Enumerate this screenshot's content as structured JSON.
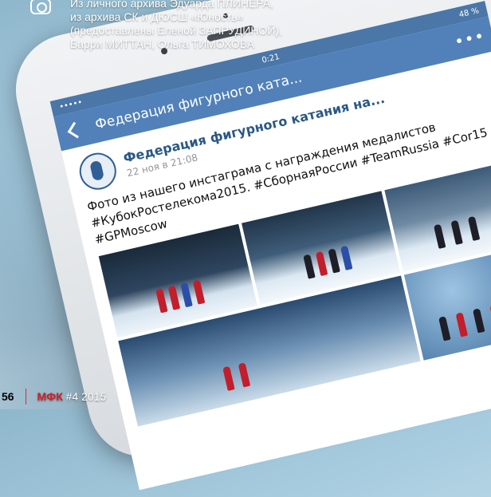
{
  "credits": {
    "lines": [
      "Из личного архива Эдуарда ПЛИНЕРА,",
      "из архива СК и ДЮСШ «Юность»",
      "(предоставлены Еленой ЗАПРУДИНОЙ),",
      "Барри МИТТАН, Ольга ТИМОХОВА"
    ],
    "icon": "camera-icon"
  },
  "phone": {
    "status_bar": {
      "time": "0:21",
      "battery": "48 %",
      "carrier": "•••••"
    },
    "nav": {
      "title": "Федерация фигурного ката...",
      "more": "•••"
    },
    "post": {
      "author": "Федерация фигурного катания на...",
      "date": "22 ноя в 21:08",
      "text": "Фото из нашего инстаграма с награждения медалистов #КубокРостелекома2015. #СборнаяРоссии #TeamRussia #Cor15 #GPMoscow"
    }
  },
  "folio": {
    "page_number": "56",
    "magazine_name": "МФК",
    "issue": "#4 2015"
  },
  "colors": {
    "vk_header": "#5181b8",
    "vk_status": "#4a76a8",
    "link": "#2a5885",
    "magazine_red": "#d31f26"
  }
}
